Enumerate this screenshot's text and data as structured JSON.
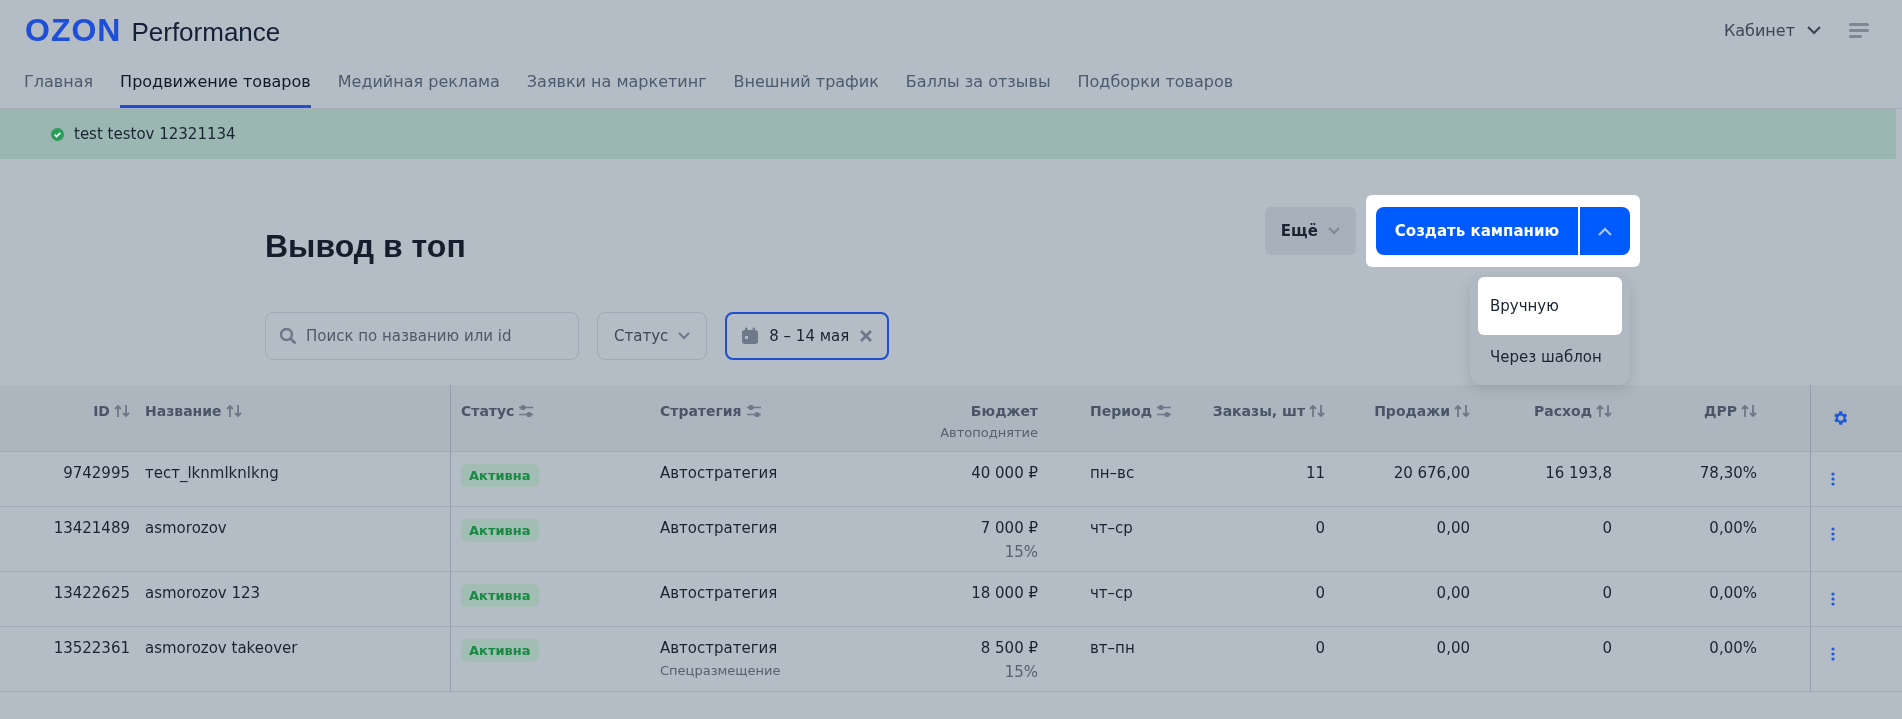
{
  "header": {
    "logo_brand": "OZON",
    "logo_product": "Performance",
    "account": "Кабинет"
  },
  "tabs": [
    {
      "label": "Главная",
      "selected": false
    },
    {
      "label": "Продвижение товаров",
      "selected": true
    },
    {
      "label": "Медийная реклама",
      "selected": false
    },
    {
      "label": "Заявки на маркетинг",
      "selected": false
    },
    {
      "label": "Внешний трафик",
      "selected": false
    },
    {
      "label": "Баллы за отзывы",
      "selected": false
    },
    {
      "label": "Подборки товаров",
      "selected": false
    }
  ],
  "notice": {
    "text": "test testov 12321134"
  },
  "page": {
    "title": "Вывод в топ",
    "more_button": "Ещё",
    "create_button": "Создать кампанию",
    "create_menu": [
      {
        "label": "Вручную",
        "selected": true
      },
      {
        "label": "Через шаблон",
        "selected": false
      }
    ]
  },
  "filters": {
    "search": {
      "placeholder": "Поиск по названию или id"
    },
    "status": "Статус",
    "date": "8 – 14 мая"
  },
  "table": {
    "columns": [
      {
        "label": "ID"
      },
      {
        "label": "Название"
      },
      {
        "label": "Статус"
      },
      {
        "label": "Стратегия"
      },
      {
        "label": "Бюджет",
        "sub": "Автоподнятие"
      },
      {
        "label": "Период"
      },
      {
        "label": "Заказы, шт"
      },
      {
        "label": "Продажи"
      },
      {
        "label": "Расход"
      },
      {
        "label": "ДРР"
      }
    ],
    "rows": [
      {
        "id": "9742995",
        "name": "тест_lknmlknlkng",
        "status": "Активна",
        "strategy": "Автостратегия",
        "budget": "40 000 ₽",
        "period": "пн–вс",
        "orders": "11",
        "sales": "20 676,00",
        "expense": "16 193,8",
        "drr": "78,30%"
      },
      {
        "id": "13421489",
        "name": "asmorozov",
        "status": "Активна",
        "strategy": "Автостратегия",
        "budget": "7 000 ₽",
        "budget_note": "15%",
        "period": "чт–ср",
        "orders": "0",
        "sales": "0,00",
        "expense": "0",
        "drr": "0,00%"
      },
      {
        "id": "13422625",
        "name": "asmorozov 123",
        "status": "Активна",
        "strategy": "Автостратегия",
        "budget": "18 000 ₽",
        "period": "чт–ср",
        "orders": "0",
        "sales": "0,00",
        "expense": "0",
        "drr": "0,00%"
      },
      {
        "id": "13522361",
        "name": "asmorozov takeover",
        "status": "Активна",
        "strategy": "Автостратегия",
        "strategy_note": "Спецразмещение",
        "budget": "8 500 ₽",
        "budget_note": "15%",
        "period": "вт–пн",
        "orders": "0",
        "sales": "0,00",
        "expense": "0",
        "drr": "0,00%"
      }
    ]
  }
}
